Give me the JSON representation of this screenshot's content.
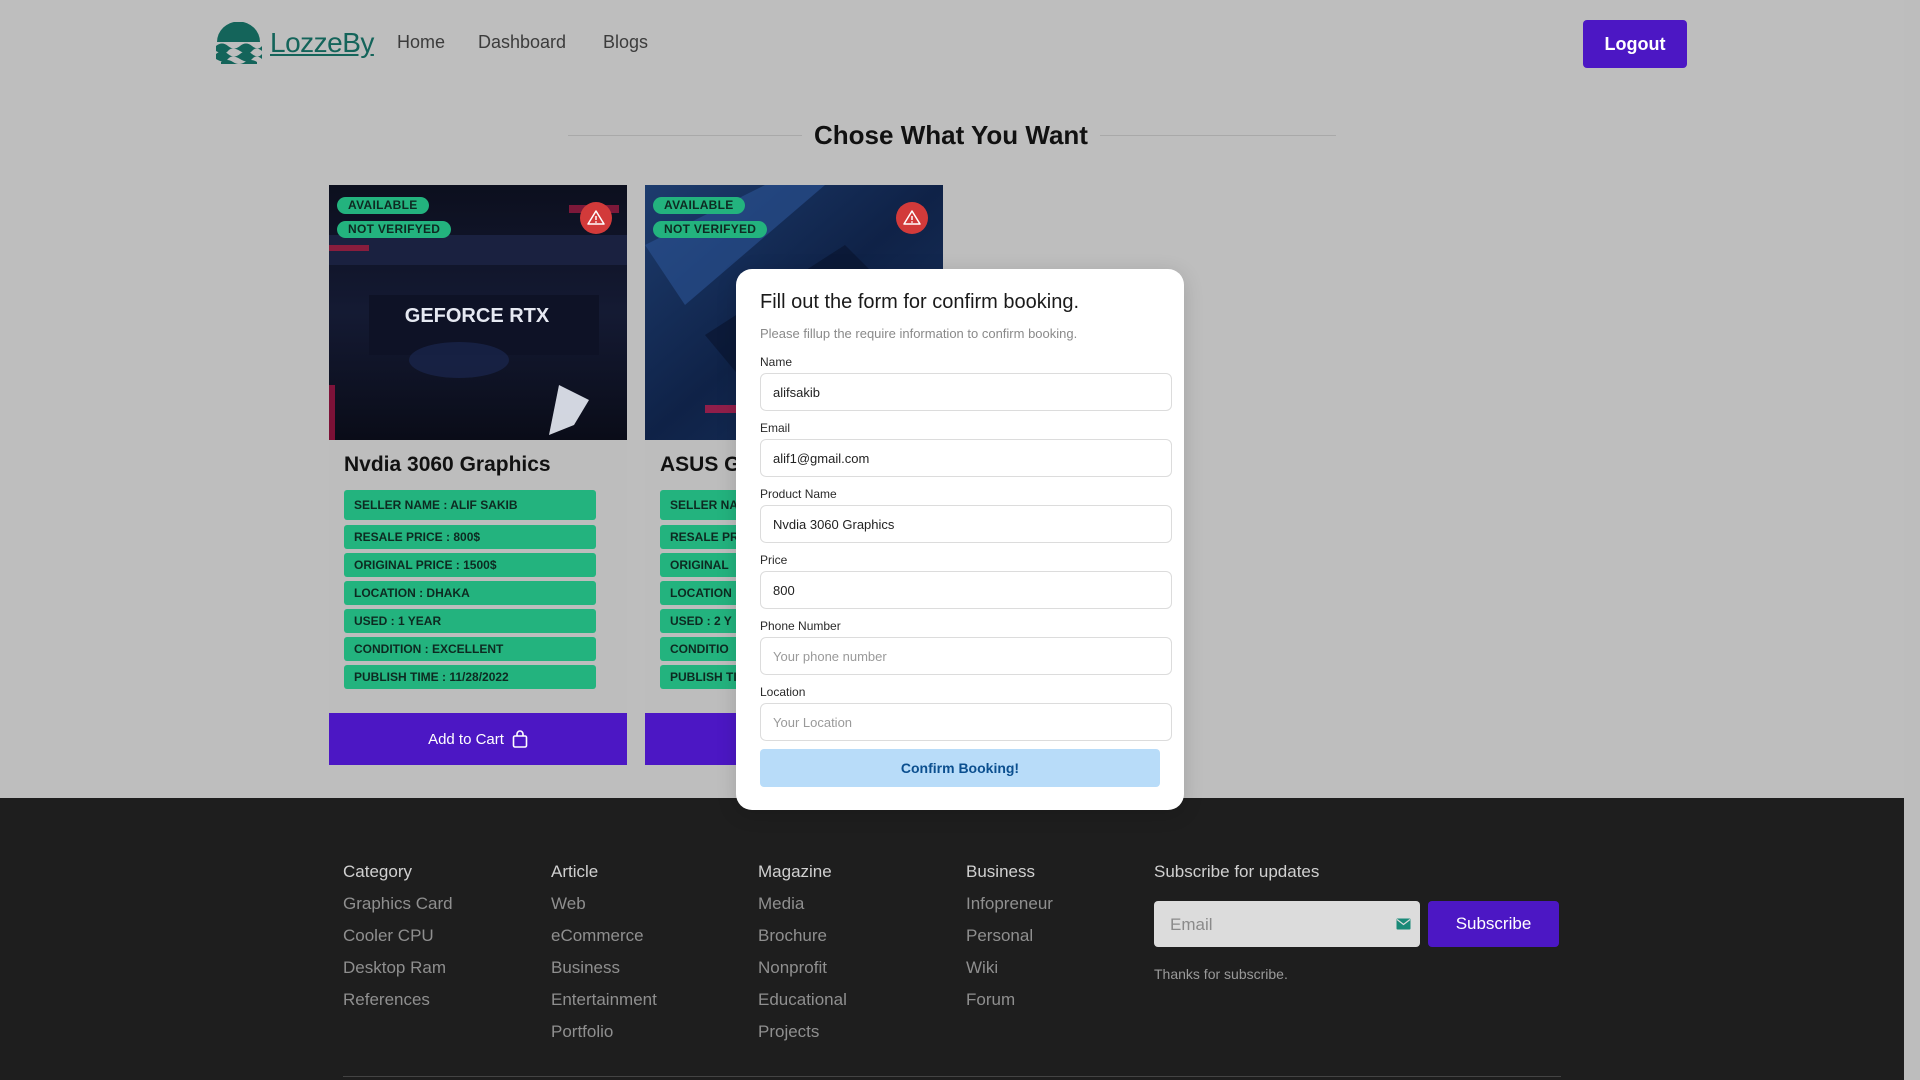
{
  "header": {
    "logo_text": "LozzeBy",
    "nav": [
      "Home",
      "Dashboard",
      "Blogs"
    ],
    "logout_label": "Logout"
  },
  "section": {
    "title": "Chose What You Want"
  },
  "cards": [
    {
      "badges": [
        "AVAILABLE",
        "NOT VERIFYED"
      ],
      "image_text": "GEFORCE RTX",
      "title": "Nvdia 3060 Graphics",
      "details": [
        "SELLER NAME : ALIF SAKIB",
        "RESALE PRICE : 800$",
        "ORIGINAL PRICE : 1500$",
        "LOCATION : DHAKA",
        "USED : 1 YEAR",
        "CONDITION : EXCELLENT",
        "PUBLISH TIME : 11/28/2022"
      ],
      "cart_label": "Add to Cart"
    },
    {
      "badges": [
        "AVAILABLE",
        "NOT VERIFYED"
      ],
      "title": "ASUS Gp",
      "details": [
        "SELLER NA",
        "RESALE PR",
        "ORIGINAL",
        "LOCATION",
        "USED : 2 Y",
        "CONDITIO",
        "PUBLISH TI"
      ]
    }
  ],
  "modal": {
    "title": "Fill out the form for confirm booking.",
    "subtitle": "Please fillup the require information to confirm booking.",
    "fields": [
      {
        "label": "Name",
        "value": "alifsakib",
        "placeholder": ""
      },
      {
        "label": "Email",
        "value": "alif1@gmail.com",
        "placeholder": ""
      },
      {
        "label": "Product Name",
        "value": "Nvdia 3060 Graphics",
        "placeholder": ""
      },
      {
        "label": "Price",
        "value": "800",
        "placeholder": ""
      },
      {
        "label": "Phone Number",
        "value": "",
        "placeholder": "Your phone number"
      },
      {
        "label": "Location",
        "value": "",
        "placeholder": "Your Location"
      }
    ],
    "confirm_label": "Confirm Booking!"
  },
  "footer": {
    "columns": [
      {
        "heading": "Category",
        "links": [
          "Graphics Card",
          "Cooler CPU",
          "Desktop Ram",
          "References"
        ]
      },
      {
        "heading": "Article",
        "links": [
          "Web",
          "eCommerce",
          "Business",
          "Entertainment",
          "Portfolio"
        ]
      },
      {
        "heading": "Magazine",
        "links": [
          "Media",
          "Brochure",
          "Nonprofit",
          "Educational",
          "Projects"
        ]
      },
      {
        "heading": "Business",
        "links": [
          "Infopreneur",
          "Personal",
          "Wiki",
          "Forum"
        ]
      }
    ],
    "subscribe": {
      "heading": "Subscribe for updates",
      "email_placeholder": "Email",
      "button_label": "Subscribe",
      "thanks_text": "Thanks for subscribe."
    }
  },
  "colors": {
    "brand": "#4c17c4",
    "badge_green": "#23b37e",
    "report_red": "#d23a3a",
    "confirm_blue": "#b8dcf9",
    "footer_bg": "#1e1e1e"
  },
  "icons": {
    "logo": "waves-logo-icon",
    "report": "warning-triangle-icon",
    "cart": "shopping-bag-icon",
    "email": "mail-icon"
  }
}
